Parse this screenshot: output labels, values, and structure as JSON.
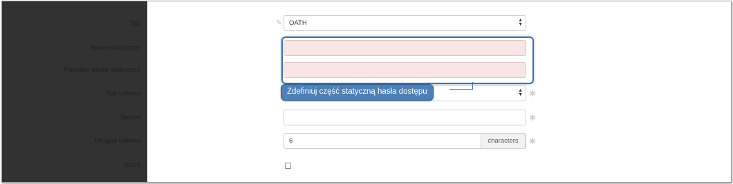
{
  "form": {
    "typ": {
      "label": "Typ",
      "value": "OATH"
    },
    "haslo": {
      "label": "Hasło statyczne",
      "value": ""
    },
    "powtorz": {
      "label": "Powtórz hasło statyczne",
      "value": ""
    },
    "typ_tokenu": {
      "label": "Typ tokenu",
      "value": ""
    },
    "sekret": {
      "label": "Sekret",
      "value": ""
    },
    "dlugosc": {
      "label": "Długoś tokenu",
      "value": "6",
      "addon": "characters"
    },
    "usun": {
      "label": "Usuń"
    }
  },
  "tooltip": {
    "text": "Zdefiniuj część statyczną hasła dostępu"
  },
  "icons": [
    "edit-icon",
    "select-arrows-icon",
    "required-asterisk-icon"
  ],
  "colors": {
    "sidebar": "#323232",
    "error_field": "#f7e6e3",
    "highlight": "#3f6fa3",
    "tooltip_bg": "#4d80b5"
  }
}
